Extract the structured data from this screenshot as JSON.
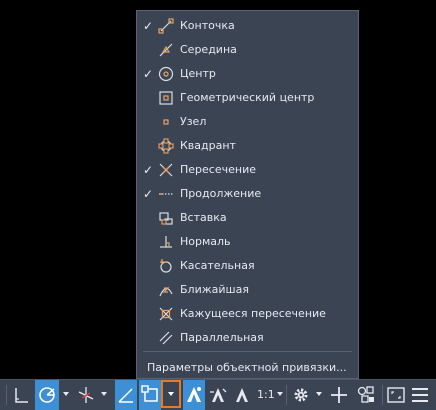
{
  "menu": {
    "items": [
      {
        "label": "Конточка",
        "checked": true,
        "icon": "endpoint-icon"
      },
      {
        "label": "Середина",
        "checked": false,
        "icon": "midpoint-icon"
      },
      {
        "label": "Центр",
        "checked": true,
        "icon": "center-icon"
      },
      {
        "label": "Геометрический центр",
        "checked": false,
        "icon": "geometric-center-icon"
      },
      {
        "label": "Узел",
        "checked": false,
        "icon": "node-icon"
      },
      {
        "label": "Квадрант",
        "checked": false,
        "icon": "quadrant-icon"
      },
      {
        "label": "Пересечение",
        "checked": true,
        "icon": "intersection-icon"
      },
      {
        "label": "Продолжение",
        "checked": true,
        "icon": "extension-icon"
      },
      {
        "label": "Вставка",
        "checked": false,
        "icon": "insertion-icon"
      },
      {
        "label": "Нормаль",
        "checked": false,
        "icon": "perpendicular-icon"
      },
      {
        "label": "Касательная",
        "checked": false,
        "icon": "tangent-icon"
      },
      {
        "label": "Ближайшая",
        "checked": false,
        "icon": "nearest-icon"
      },
      {
        "label": "Кажущееся пересечение",
        "checked": false,
        "icon": "apparent-intersection-icon"
      },
      {
        "label": "Параллельная",
        "checked": false,
        "icon": "parallel-icon"
      }
    ],
    "check_glyph": "✓",
    "settings_label": "Параметры объектной привязки..."
  },
  "statusbar": {
    "annotation_scale": "1:1"
  },
  "colors": {
    "menu_bg": "#3b4453",
    "text": "#e6eaf0",
    "snap_marker": "#e8a066",
    "active_button": "#3d8fd6",
    "highlight_border": "#e87a22"
  }
}
